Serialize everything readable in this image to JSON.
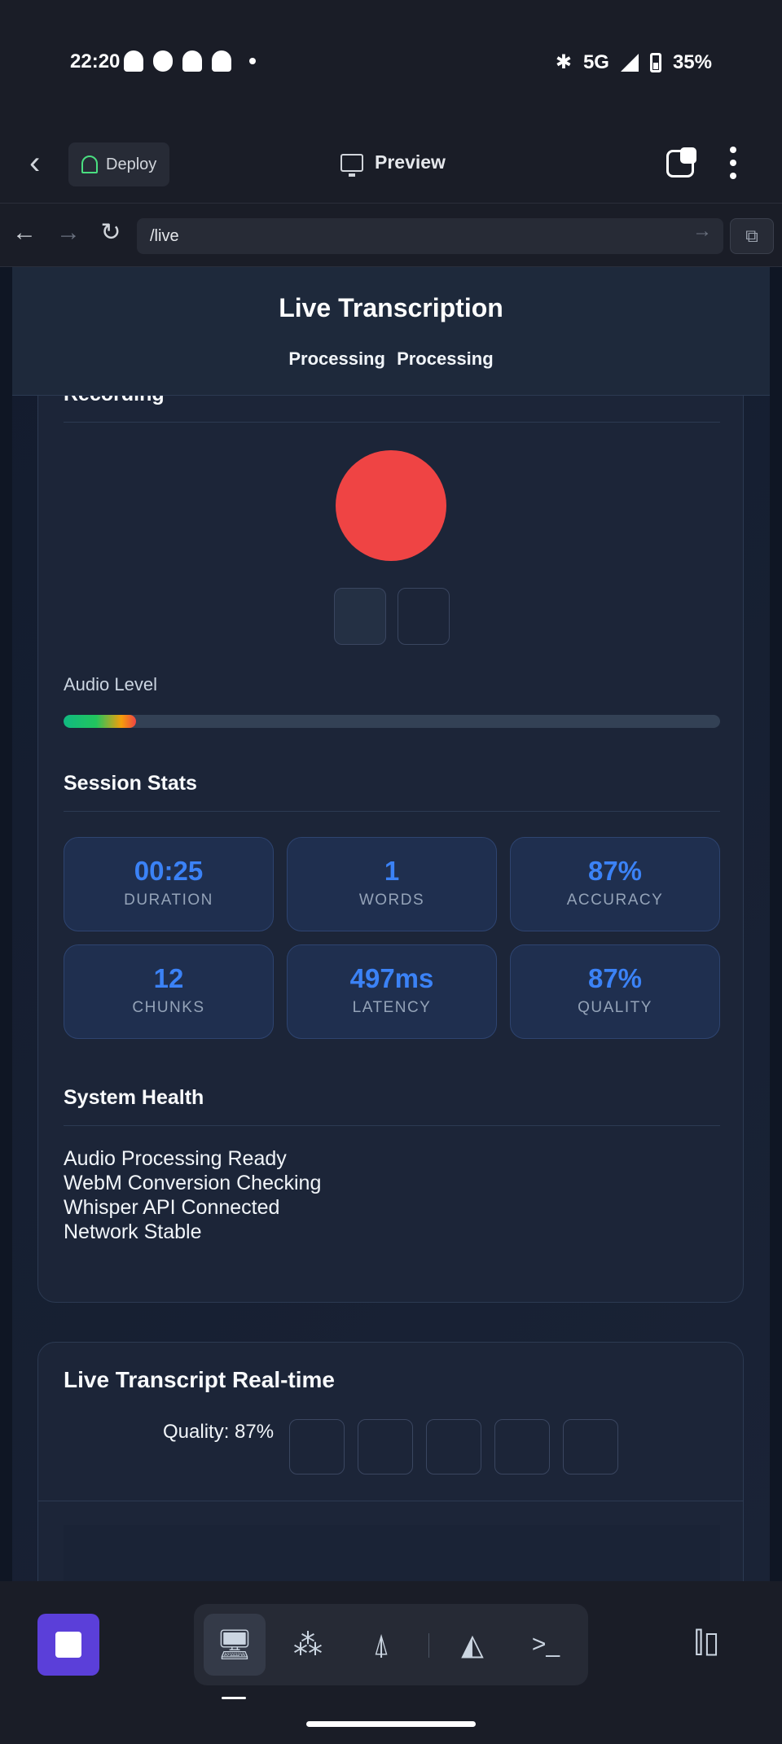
{
  "status_bar": {
    "time": "22:20",
    "network": "5G",
    "battery": "35%",
    "icons": [
      "snapchat-icon",
      "chat-icon",
      "snapchat-icon",
      "snapchat-icon",
      "notification-dot",
      "bluetooth-icon",
      "signal-icon",
      "battery-icon"
    ]
  },
  "app_header": {
    "deploy_label": "Deploy",
    "title": "Preview"
  },
  "browser": {
    "url": "/live"
  },
  "page": {
    "title": "Live Transcription",
    "status": [
      "Processing",
      "Processing"
    ],
    "recording": {
      "title": "Recording",
      "audio_level_label": "Audio Level",
      "audio_level": 0.11
    },
    "session_stats": {
      "title": "Session Stats",
      "items": [
        {
          "value": "00:25",
          "label": "DURATION"
        },
        {
          "value": "1",
          "label": "WORDS"
        },
        {
          "value": "87%",
          "label": "ACCURACY"
        },
        {
          "value": "12",
          "label": "CHUNKS"
        },
        {
          "value": "497ms",
          "label": "LATENCY"
        },
        {
          "value": "87%",
          "label": "QUALITY"
        }
      ]
    },
    "system_health": {
      "title": "System Health",
      "items": [
        "Audio Processing Ready",
        "WebM Conversion Checking",
        "Whisper API Connected",
        "Network Stable"
      ]
    },
    "live_transcript": {
      "title": "Live Transcript Real-time",
      "quality_label": "Quality: 87%"
    }
  },
  "colors": {
    "accent": "#3b82f6",
    "record": "#ef4444",
    "stop_button": "#5b3fd9"
  }
}
